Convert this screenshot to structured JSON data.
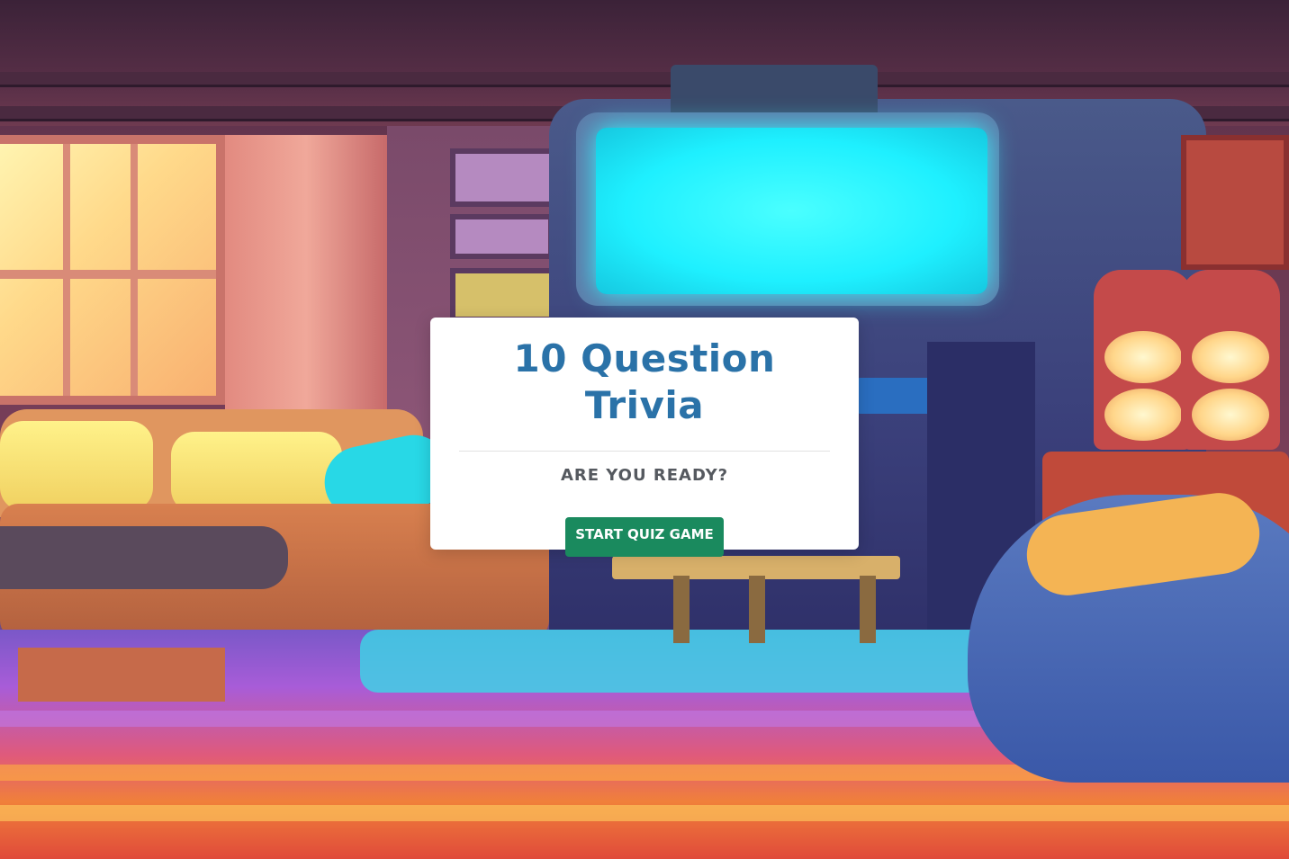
{
  "title": "10 Question Trivia",
  "subtitle": "ARE YOU READY?",
  "start_button_label": "START QUIZ GAME",
  "colors": {
    "title": "#2a72a8",
    "button_bg": "#1a8a5e",
    "button_text": "#ffffff",
    "subtitle": "#55595f",
    "modal_bg": "#ffffff"
  },
  "background": {
    "description_icon": "cartoon-game-room-background"
  }
}
